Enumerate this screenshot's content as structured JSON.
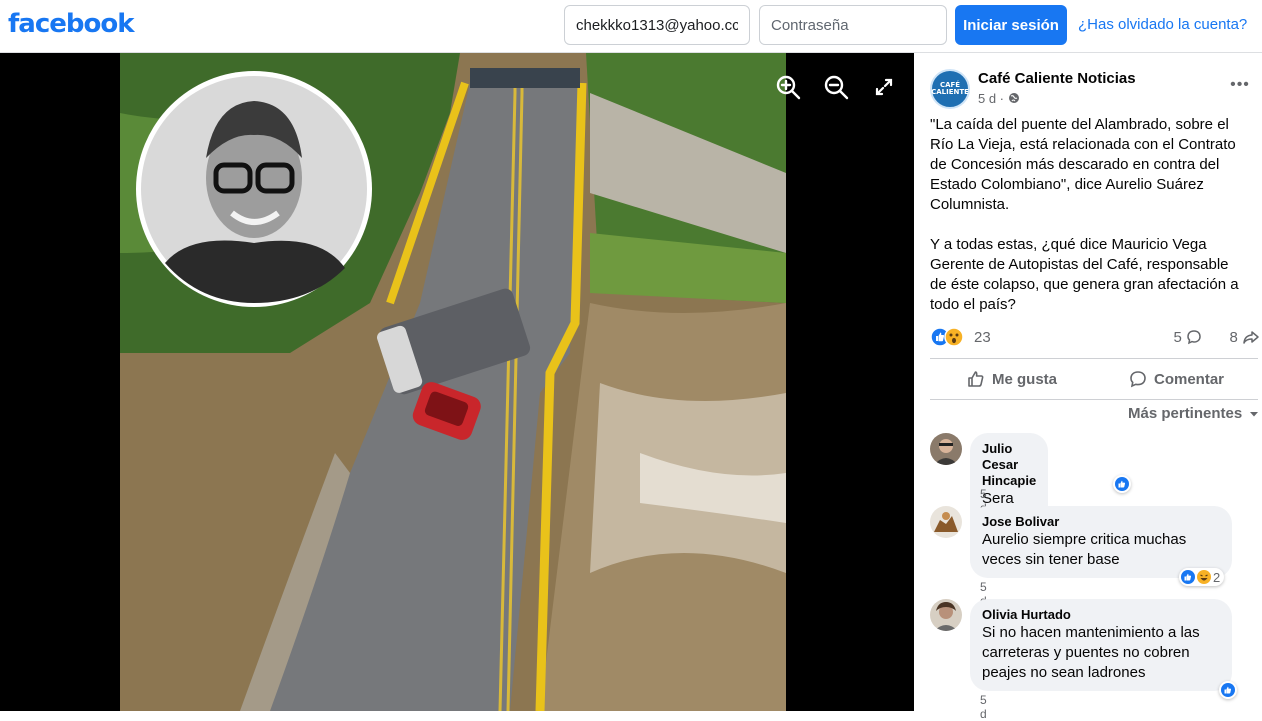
{
  "header": {
    "logo": "facebook",
    "email_value": "chekkko1313@yahoo.cc",
    "password_placeholder": "Contraseña",
    "login_label": "Iniciar sesión",
    "forgot_label": "¿Has olvidado la cuenta?"
  },
  "colors": {
    "brand": "#1877f2",
    "link": "#1877f2",
    "secondary_text": "#65676b",
    "bubble_bg": "#f0f2f5"
  },
  "viewer": {
    "tools": [
      "zoom-in-icon",
      "zoom-out-icon",
      "fullscreen-icon"
    ]
  },
  "post": {
    "page_name": "Café Caliente Noticias",
    "avatar_text_1": "CAFÉ",
    "avatar_text_2": "CALIENTE",
    "time": "5 d ·",
    "text": "\"La caída del puente del Alambrado, sobre el Río La Vieja, está relacionada con el Contrato de Concesión más descarado en contra del Estado Colombiano\", dice Aurelio Suárez Columnista.\n\nY a todas estas, ¿qué dice Mauricio Vega Gerente de Autopistas del Café, responsable de éste colapso, que genera gran afectación a todo el país?",
    "reaction_count": "23",
    "comment_count": "5",
    "share_count": "8",
    "like_label": "Me gusta",
    "comment_label": "Comentar",
    "sort_label": "Más pertinentes"
  },
  "comments": [
    {
      "author": "Julio Cesar Hincapie",
      "text": "Sera culpa de petro",
      "time": "5 d",
      "reactions": ""
    },
    {
      "author": "Jose Bolivar",
      "text": "Aurelio siempre critica muchas veces sin tener base",
      "time": "5 d",
      "reactions": "2"
    },
    {
      "author": "Olivia Hurtado",
      "text": "Si no hacen mantenimiento a las carreteras y puentes no cobren peajes no sean ladrones",
      "time": "5 d",
      "reactions": ""
    }
  ]
}
